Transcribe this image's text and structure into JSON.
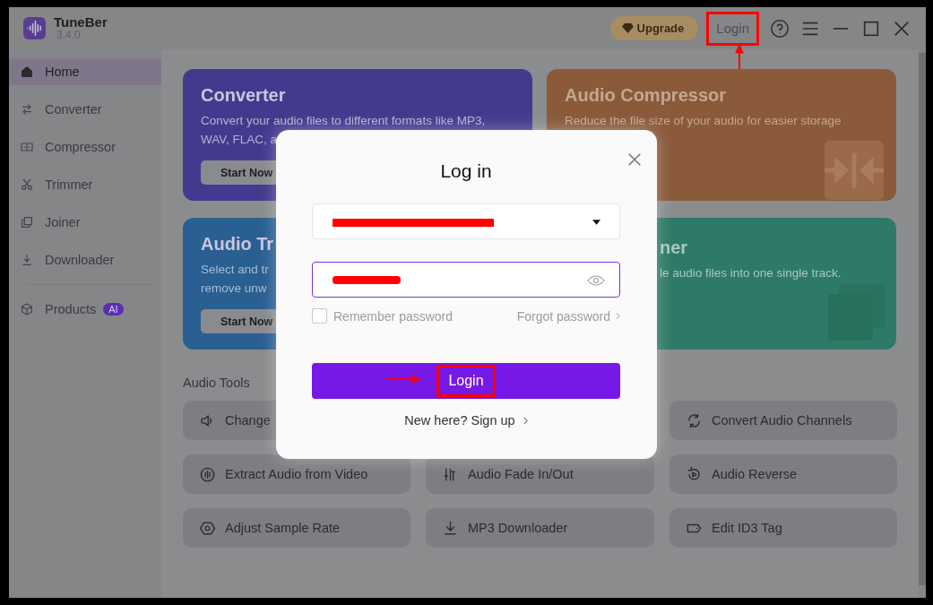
{
  "app": {
    "name": "TuneBer",
    "version": "3.4.0"
  },
  "header": {
    "upgrade": "Upgrade",
    "login": {
      "label": "Login",
      "highlighted": true
    }
  },
  "sidebar": {
    "items": [
      {
        "label": "Home",
        "selected": true
      },
      {
        "label": "Converter",
        "selected": false
      },
      {
        "label": "Compressor",
        "selected": false
      },
      {
        "label": "Trimmer",
        "selected": false
      },
      {
        "label": "Joiner",
        "selected": false
      },
      {
        "label": "Downloader",
        "selected": false
      },
      {
        "label": "Products",
        "selected": false,
        "badge": "AI"
      }
    ]
  },
  "cards": [
    {
      "title": "Converter",
      "desc_lines": [
        "Convert your audio files to different formats like MP3,",
        "WAV, FLAC, a"
      ],
      "button": "Start Now",
      "color": "#433a8f"
    },
    {
      "title": "Audio Compressor",
      "desc_lines": [
        "Reduce the file size of your audio for easier storage"
      ],
      "color": "#8a5a3b"
    },
    {
      "title": "Audio Tr",
      "desc_lines": [
        "Select and tr",
        "remove unw"
      ],
      "button": "Start Now",
      "color": "#2a5f92"
    },
    {
      "title": "ner",
      "desc_lines": [
        "le audio files into one single track."
      ],
      "color": "#2e7a68"
    }
  ],
  "tools_heading": "Audio Tools",
  "tools": [
    "Change",
    "Convert Audio Channels",
    "Extract Audio from Video",
    "Audio Fade In/Out",
    "Audio Reverse",
    "Adjust Sample Rate",
    "MP3 Downloader",
    "Edit ID3 Tag"
  ],
  "dialog": {
    "title": "Log in",
    "email_field": {
      "redacted": true
    },
    "password_field": {
      "redacted": true,
      "focused": true
    },
    "remember": {
      "label": "Remember password",
      "checked": false
    },
    "forgot": "Forgot password",
    "login_button": {
      "label": "Login",
      "highlighted": true
    },
    "signup": "New here? Sign up"
  }
}
